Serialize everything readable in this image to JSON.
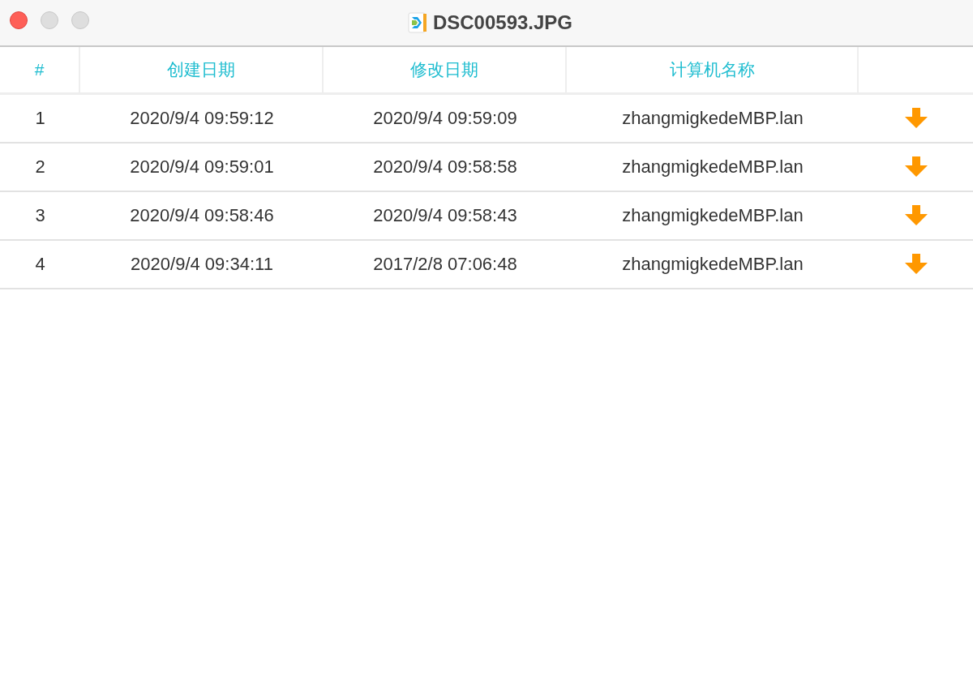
{
  "window": {
    "title": "DSC00593.JPG"
  },
  "table": {
    "columns": [
      "#",
      "创建日期",
      "修改日期",
      "计算机名称"
    ],
    "rows": [
      {
        "cells": [
          "1",
          "2020/9/4 09:59:12",
          "2020/9/4 09:59:09",
          "zhangmigkedeMBP.lan"
        ]
      },
      {
        "cells": [
          "2",
          "2020/9/4 09:59:01",
          "2020/9/4 09:58:58",
          "zhangmigkedeMBP.lan"
        ]
      },
      {
        "cells": [
          "3",
          "2020/9/4 09:58:46",
          "2020/9/4 09:58:43",
          "zhangmigkedeMBP.lan"
        ]
      },
      {
        "cells": [
          "4",
          "2020/9/4 09:34:11",
          "2017/2/8 07:06:48",
          "zhangmigkedeMBP.lan"
        ]
      }
    ]
  }
}
